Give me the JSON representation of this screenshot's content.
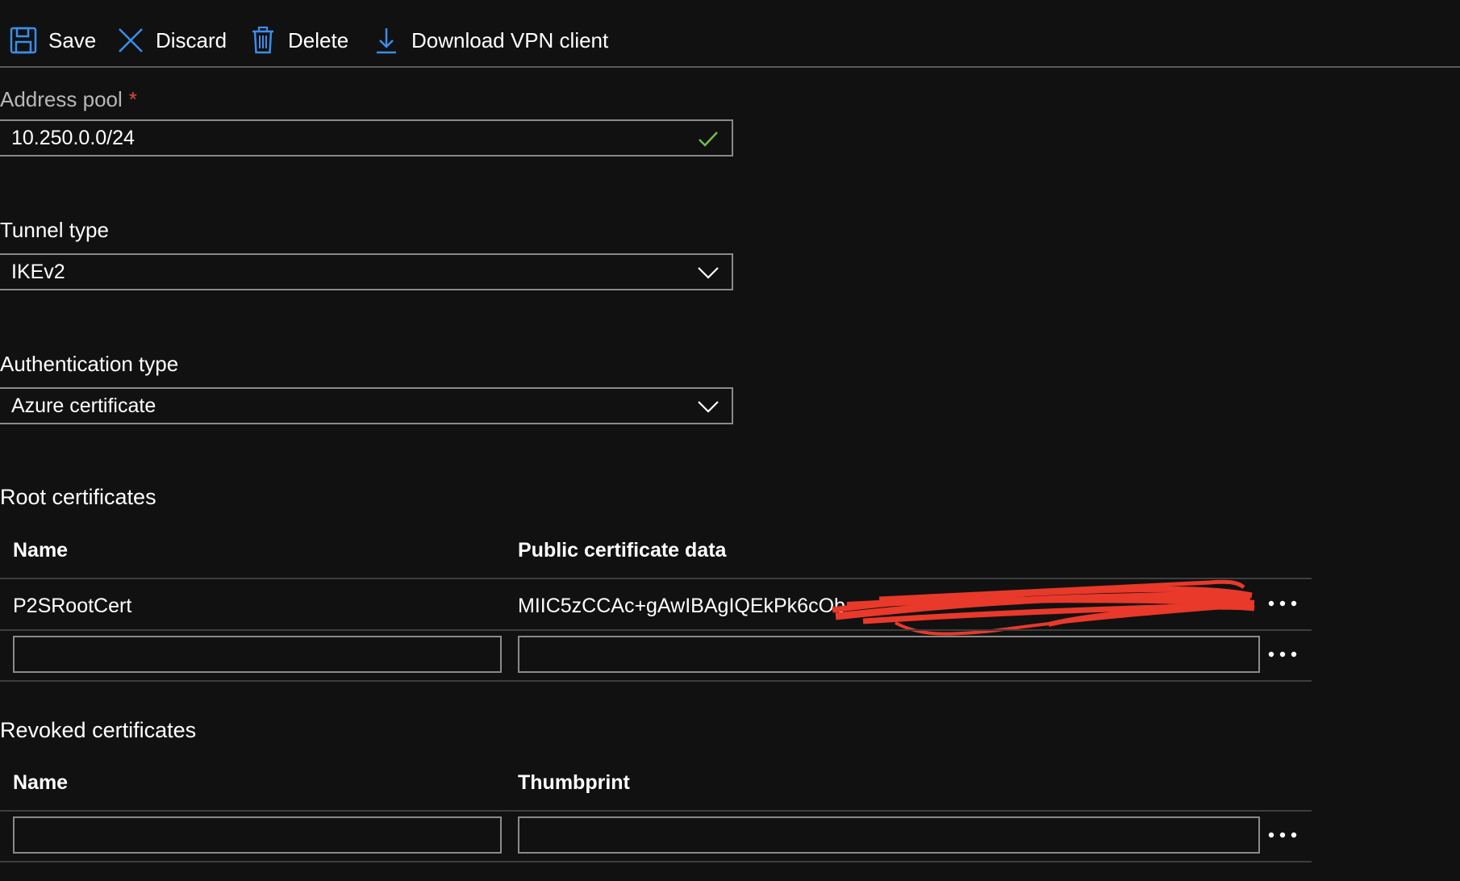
{
  "toolbar": {
    "save_label": "Save",
    "discard_label": "Discard",
    "delete_label": "Delete",
    "download_label": "Download VPN client"
  },
  "address_pool": {
    "label": "Address pool",
    "required_marker": "*",
    "value": "10.250.0.0/24",
    "status_icon": "check-icon"
  },
  "tunnel_type": {
    "label": "Tunnel type",
    "selected": "IKEv2"
  },
  "authentication_type": {
    "label": "Authentication type",
    "selected": "Azure certificate"
  },
  "root_certificates": {
    "title": "Root certificates",
    "columns": [
      "Name",
      "Public certificate data"
    ],
    "rows": [
      {
        "name": "P2SRootCert",
        "public_certificate_data": "MIIC5zCCAc+gAwIBAgIQEkPk6cOb"
      }
    ],
    "new_row": {
      "name": "",
      "public_certificate_data": ""
    }
  },
  "revoked_certificates": {
    "title": "Revoked certificates",
    "columns": [
      "Name",
      "Thumbprint"
    ],
    "new_row": {
      "name": "",
      "thumbprint": ""
    }
  },
  "colors": {
    "background": "#111111",
    "accent": "#3b8eea",
    "success": "#6fbf4a",
    "required": "#e04a3a",
    "redaction": "#e8392a"
  }
}
